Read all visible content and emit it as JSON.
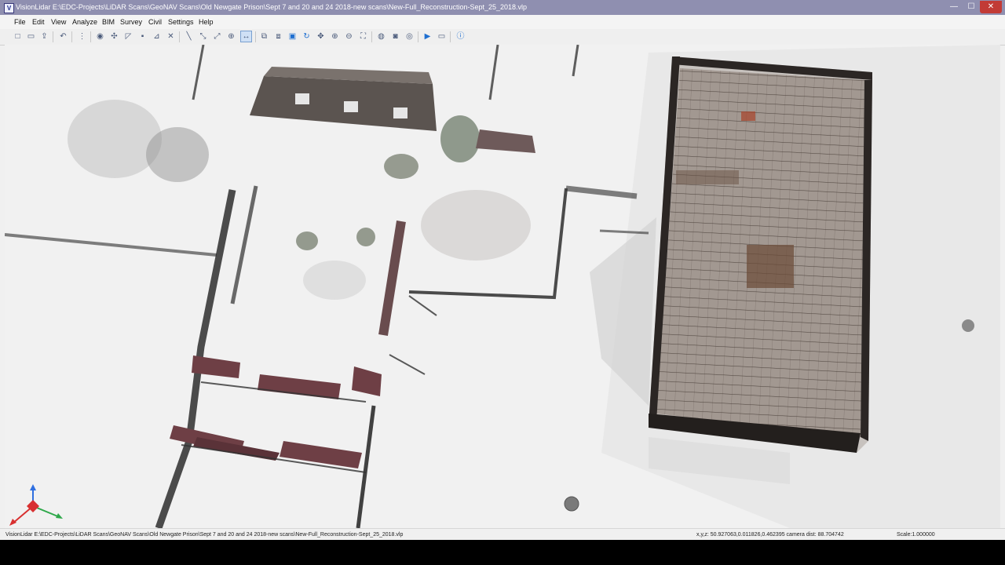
{
  "window": {
    "title": "VisionLidar  E:\\EDC-Projects\\LiDAR Scans\\GeoNAV Scans\\Old Newgate Prison\\Sept 7 and 20 and 24 2018-new scans\\New-Full_Reconstruction-Sept_25_2018.vlp",
    "app_icon_letter": "V",
    "minimize_glyph": "—",
    "maximize_glyph": "☐",
    "close_glyph": "✕"
  },
  "menu": {
    "items": [
      "File",
      "Edit",
      "View",
      "Analyze",
      "BIM",
      "Survey",
      "Civil",
      "Settings",
      "Help"
    ]
  },
  "toolbar": {
    "icons": [
      {
        "name": "new-file-icon",
        "glyph": "□"
      },
      {
        "name": "open-folder-icon",
        "glyph": "▭"
      },
      {
        "name": "export-icon",
        "glyph": "⇪"
      },
      {
        "name": "undo-icon",
        "glyph": "↶"
      },
      {
        "name": "grid-select-icon",
        "glyph": "⋮"
      },
      {
        "name": "cylinder-icon",
        "glyph": "◉"
      },
      {
        "name": "move-point-icon",
        "glyph": "✣"
      },
      {
        "name": "polygon-select-icon",
        "glyph": "◸"
      },
      {
        "name": "delete-icon",
        "glyph": "▪"
      },
      {
        "name": "pick-icon",
        "glyph": "⊿"
      },
      {
        "name": "cross-select-icon",
        "glyph": "✕"
      },
      {
        "name": "line-measure-icon",
        "glyph": "╲"
      },
      {
        "name": "segment-icon",
        "glyph": "⤡"
      },
      {
        "name": "axis-icon",
        "glyph": "⤢"
      },
      {
        "name": "target-icon",
        "glyph": "⊕"
      },
      {
        "name": "measure-distance-icon",
        "glyph": "↔"
      },
      {
        "name": "cube-view-icon",
        "glyph": "⧉"
      },
      {
        "name": "front-view-icon",
        "glyph": "⧈"
      },
      {
        "name": "box-view-icon",
        "glyph": "▣"
      },
      {
        "name": "rotate-icon",
        "glyph": "↻"
      },
      {
        "name": "pan-icon",
        "glyph": "✥"
      },
      {
        "name": "zoom-in-icon",
        "glyph": "⊕"
      },
      {
        "name": "zoom-out-icon",
        "glyph": "⊖"
      },
      {
        "name": "zoom-extent-icon",
        "glyph": "⛶"
      },
      {
        "name": "camera-icon",
        "glyph": "◍"
      },
      {
        "name": "record-icon",
        "glyph": "◙"
      },
      {
        "name": "eye-icon",
        "glyph": "◎"
      },
      {
        "name": "play-icon",
        "glyph": "▶"
      },
      {
        "name": "screen-icon",
        "glyph": "▭"
      },
      {
        "name": "info-icon",
        "glyph": "ⓘ"
      }
    ]
  },
  "status": {
    "path": "VisionLidar  E:\\EDC-Projects\\LiDAR Scans\\GeoNAV Scans\\Old Newgate Prison\\Sept 7 and 20 and 24 2018-new scans\\New-Full_Reconstruction-Sept_25_2018.vlp",
    "coords": "x,y,z: 50.927063,0.011826,0.462395 camera dist: 88.704742",
    "scale": "Scale:1.000000"
  },
  "colors": {
    "titlebar": "#8f8fb0",
    "close_button": "#c23b36",
    "axis_x": "#d83030",
    "axis_y": "#2ea84a",
    "axis_z": "#2f6fe0"
  }
}
